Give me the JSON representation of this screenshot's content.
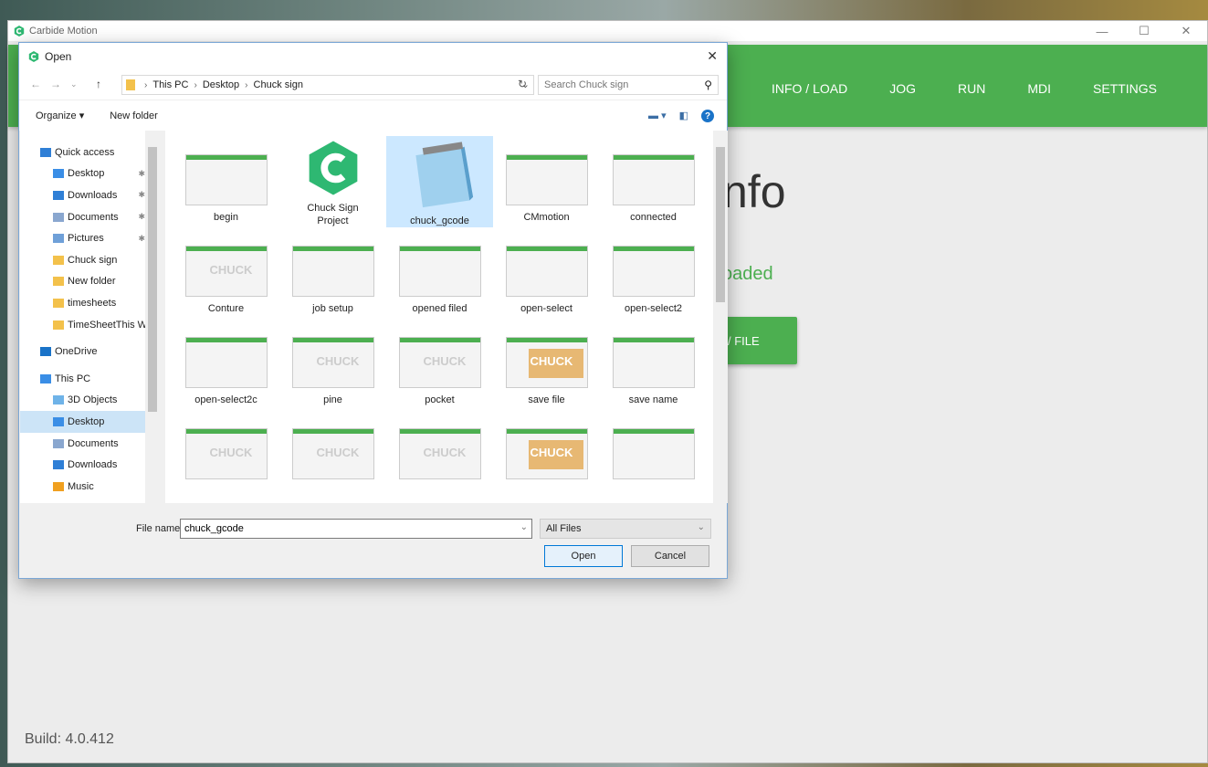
{
  "app": {
    "title": "Carbide Motion",
    "nav": [
      "INFO / LOAD",
      "JOG",
      "RUN",
      "MDI",
      "SETTINGS"
    ],
    "heading": "nfo",
    "status": "oaded",
    "load_button": "/ FILE",
    "build": "Build: 4.0.412",
    "win_controls": {
      "minimize": "—",
      "maximize": "☐",
      "close": "✕"
    },
    "brand_color": "#4caf50"
  },
  "dialog": {
    "title": "Open",
    "close": "✕",
    "path": [
      "This PC",
      "Desktop",
      "Chuck sign"
    ],
    "search_placeholder": "Search Chuck sign",
    "toolbar": {
      "organize": "Organize ▾",
      "new_folder": "New folder"
    },
    "nav_items": [
      {
        "label": "Quick access",
        "icon": "star-icon",
        "indent": 0,
        "pin": ""
      },
      {
        "label": "Desktop",
        "icon": "folder-blue-icon",
        "indent": 1,
        "pin": "✱"
      },
      {
        "label": "Downloads",
        "icon": "download-icon",
        "indent": 1,
        "pin": "✱"
      },
      {
        "label": "Documents",
        "icon": "documents-icon",
        "indent": 1,
        "pin": "✱"
      },
      {
        "label": "Pictures",
        "icon": "pictures-icon",
        "indent": 1,
        "pin": "✱"
      },
      {
        "label": "Chuck sign",
        "icon": "folder-icon",
        "indent": 1,
        "pin": ""
      },
      {
        "label": "New folder",
        "icon": "folder-icon",
        "indent": 1,
        "pin": ""
      },
      {
        "label": "timesheets",
        "icon": "folder-icon",
        "indent": 1,
        "pin": ""
      },
      {
        "label": "TimeSheetThis W",
        "icon": "folder-icon",
        "indent": 1,
        "pin": ""
      },
      {
        "label": "OneDrive",
        "icon": "cloud-icon",
        "indent": 0,
        "pin": ""
      },
      {
        "label": "This PC",
        "icon": "computer-icon",
        "indent": 0,
        "pin": ""
      },
      {
        "label": "3D Objects",
        "icon": "cube-icon",
        "indent": 1,
        "pin": ""
      },
      {
        "label": "Desktop",
        "icon": "folder-blue-icon",
        "indent": 1,
        "pin": "",
        "selected": true
      },
      {
        "label": "Documents",
        "icon": "documents-icon",
        "indent": 1,
        "pin": ""
      },
      {
        "label": "Downloads",
        "icon": "download-icon",
        "indent": 1,
        "pin": ""
      },
      {
        "label": "Music",
        "icon": "music-icon",
        "indent": 1,
        "pin": ""
      }
    ],
    "files": [
      {
        "name": "begin",
        "kind": "shot"
      },
      {
        "name": "Chuck Sign Project",
        "kind": "logo"
      },
      {
        "name": "chuck_gcode",
        "kind": "notepad",
        "selected": true
      },
      {
        "name": "CMmotion",
        "kind": "shot"
      },
      {
        "name": "connected",
        "kind": "shot"
      },
      {
        "name": "Conture",
        "kind": "chuck"
      },
      {
        "name": "job setup",
        "kind": "shot"
      },
      {
        "name": "opened filed",
        "kind": "shot"
      },
      {
        "name": "open-select",
        "kind": "shot"
      },
      {
        "name": "open-select2",
        "kind": "shot"
      },
      {
        "name": "open-select2c",
        "kind": "shot"
      },
      {
        "name": "pine",
        "kind": "chuck"
      },
      {
        "name": "pocket",
        "kind": "chuck"
      },
      {
        "name": "save file",
        "kind": "wood"
      },
      {
        "name": "save name",
        "kind": "shot"
      },
      {
        "name": "",
        "kind": "chuck"
      },
      {
        "name": "",
        "kind": "chuck"
      },
      {
        "name": "",
        "kind": "chuck"
      },
      {
        "name": "",
        "kind": "wood"
      },
      {
        "name": "",
        "kind": "shot"
      }
    ],
    "watermark": "CHUCK",
    "file_name_label": "File name:",
    "file_name_value": "chuck_gcode",
    "file_type": "All Files",
    "open_button": "Open",
    "cancel_button": "Cancel"
  }
}
